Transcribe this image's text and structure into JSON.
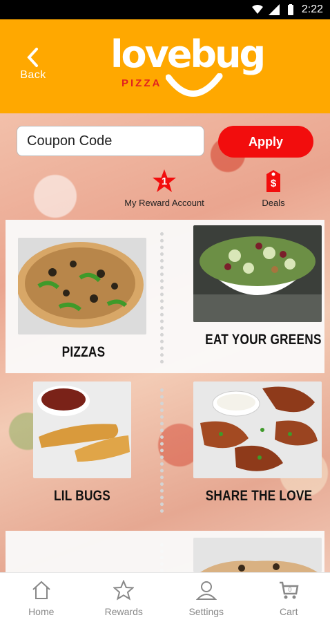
{
  "status": {
    "time": "2:22"
  },
  "header": {
    "back_label": "Back",
    "logo_text": "lovebug",
    "logo_subtext": "PIZZA"
  },
  "coupon": {
    "placeholder": "Coupon Code",
    "value": "",
    "apply_label": "Apply"
  },
  "quick_links": [
    {
      "label": "My Reward Account",
      "badge": "1",
      "icon": "star-badge-icon"
    },
    {
      "label": "Deals",
      "badge": "$",
      "icon": "price-tag-icon"
    }
  ],
  "categories": [
    {
      "label": "PIZZAS"
    },
    {
      "label": "EAT YOUR GREENS"
    },
    {
      "label": "LIL BUGS"
    },
    {
      "label": "SHARE THE LOVE"
    }
  ],
  "tabs": [
    {
      "label": "Home",
      "icon": "home-icon"
    },
    {
      "label": "Rewards",
      "icon": "star-icon"
    },
    {
      "label": "Settings",
      "icon": "person-icon"
    },
    {
      "label": "Cart",
      "icon": "cart-icon",
      "badge": "0"
    }
  ],
  "colors": {
    "brand_orange": "#ffa800",
    "accent_red": "#f20d0d",
    "tab_gray": "#888888"
  }
}
